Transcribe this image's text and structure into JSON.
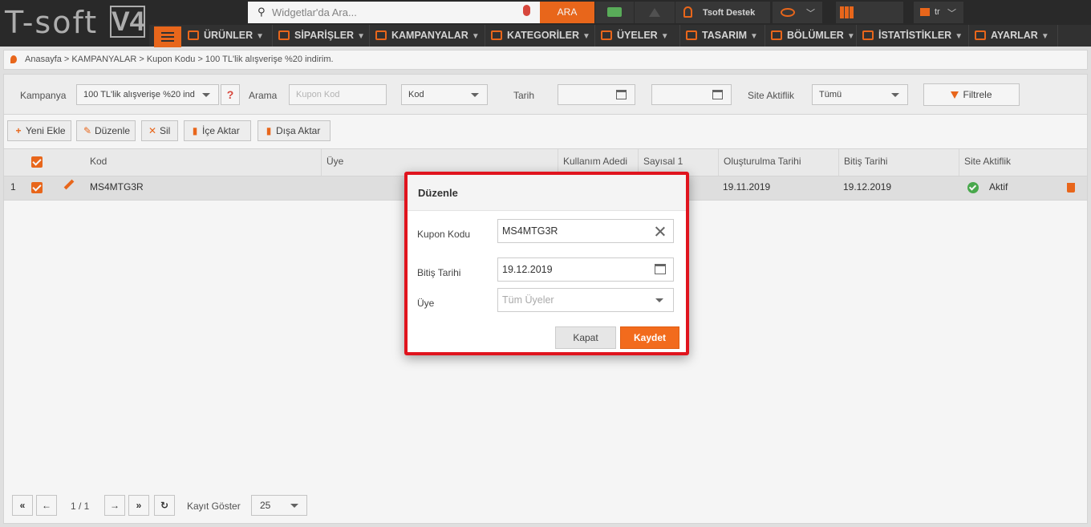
{
  "logo": {
    "text": "T-soft",
    "version": "V4"
  },
  "topbar": {
    "search_placeholder": "Widgetlar'da Ara...",
    "search_button": "ARA",
    "user_name": "Tsoft Destek",
    "language": "tr"
  },
  "nav": {
    "items": [
      {
        "label": "ÜRÜNLER"
      },
      {
        "label": "SİPARİŞLER"
      },
      {
        "label": "KAMPANYALAR"
      },
      {
        "label": "KATEGORİLER"
      },
      {
        "label": "ÜYELER"
      },
      {
        "label": "TASARIM"
      },
      {
        "label": "BÖLÜMLER"
      },
      {
        "label": "İSTATİSTİKLER"
      },
      {
        "label": "AYARLAR"
      }
    ]
  },
  "breadcrumb": "Anasayfa > KAMPANYALAR > Kupon Kodu > 100 TL'lik alışverişe %20 indirim.",
  "filters": {
    "kampanya_label": "Kampanya",
    "kampanya_value": "100 TL'lik alışverişe %20 ind",
    "help": "?",
    "arama_label": "Arama",
    "arama_placeholder": "Kupon Kod",
    "kod_value": "Kod",
    "tarih_label": "Tarih",
    "site_aktiflik_label": "Site Aktiflik",
    "site_aktiflik_value": "Tümü",
    "filter_button": "Filtrele"
  },
  "toolbar": {
    "new": "Yeni Ekle",
    "edit": "Düzenle",
    "delete": "Sil",
    "import": "İçe Aktar",
    "export": "Dışa Aktar"
  },
  "table": {
    "headers": [
      "Kod",
      "Üye",
      "Kullanım Adedi",
      "Sayısal 1",
      "Oluşturulma Tarihi",
      "Bitiş Tarihi",
      "Site Aktiflik"
    ],
    "rows": [
      {
        "index": "1",
        "kod": "MS4MTG3R",
        "olusturulma": "19.11.2019",
        "bitis": "19.12.2019",
        "aktiflik": "Aktif"
      }
    ]
  },
  "pager": {
    "page": "1 / 1",
    "kayit_label": "Kayıt Göster",
    "kayit_value": "25"
  },
  "modal": {
    "title": "Düzenle",
    "kupon_label": "Kupon Kodu",
    "kupon_value": "MS4MTG3R",
    "bitis_label": "Bitiş Tarihi",
    "bitis_value": "19.12.2019",
    "uye_label": "Üye",
    "uye_placeholder": "Tüm Üyeler",
    "close_button": "Kapat",
    "save_button": "Kaydet"
  },
  "colors": {
    "accent": "#f26b1d",
    "topbar": "#2b2b2b",
    "highlight": "#e0141e",
    "success": "#4caf50"
  }
}
